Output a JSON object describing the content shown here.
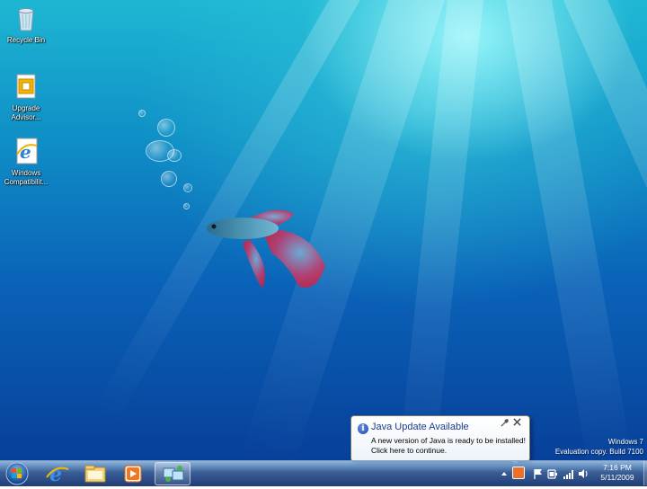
{
  "desktop": {
    "icons": [
      {
        "label": "Recycle Bin",
        "icon": "recycle-bin-icon"
      },
      {
        "label": "Upgrade Advisor...",
        "icon": "upgrade-advisor-icon"
      },
      {
        "label": "Windows Compatibilit...",
        "icon": "internet-explorer-icon"
      }
    ],
    "watermark": {
      "line1": "Windows 7",
      "line2": "Evaluation copy. Build 7100"
    }
  },
  "notification": {
    "title": "Java Update Available",
    "line1": "A new version of Java is ready to be installed!",
    "line2": "Click here to continue.",
    "options_icon": "wrench-icon",
    "close_icon": "close-icon"
  },
  "taskbar": {
    "start": "start-orb-icon",
    "pinned": [
      "internet-explorer-icon",
      "windows-explorer-icon",
      "media-player-icon",
      "network-app-icon"
    ],
    "tray": [
      "show-hidden-icons",
      "java-update-icon",
      "action-center-flag-icon",
      "power-icon",
      "network-signal-icon",
      "volume-icon"
    ],
    "clock": {
      "time": "7:16 PM",
      "date": "5/11/2009"
    }
  }
}
